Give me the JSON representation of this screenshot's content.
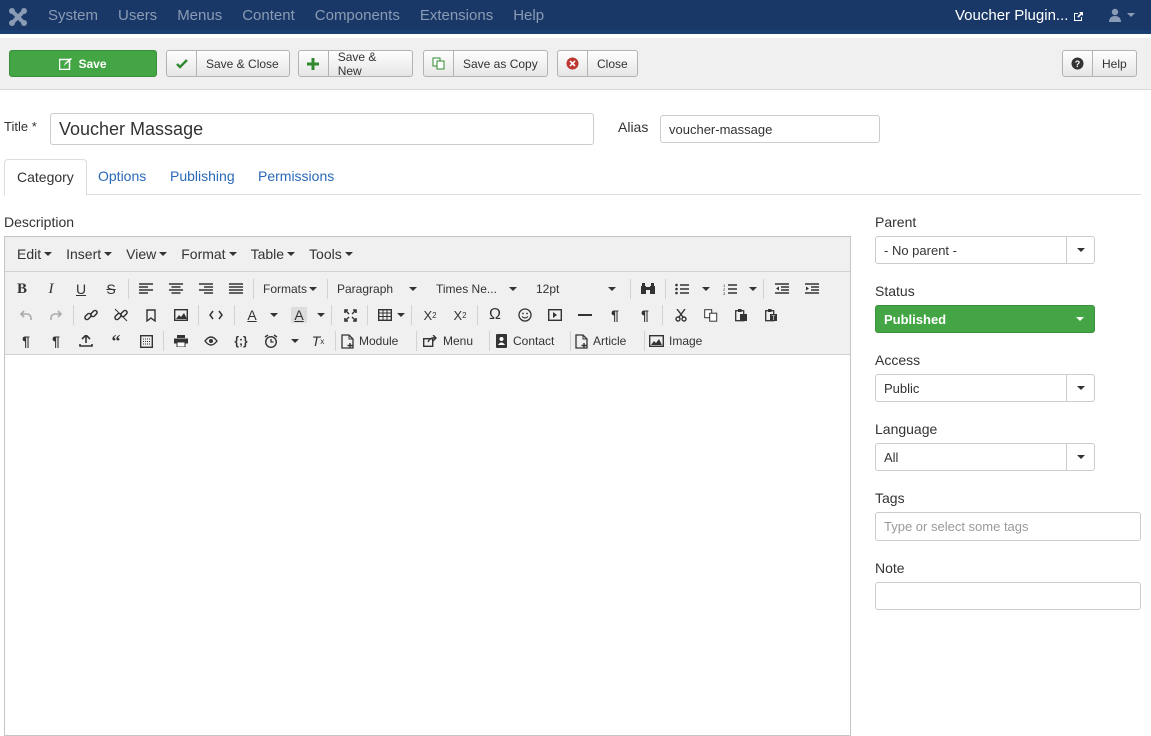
{
  "navbar": {
    "menu": [
      "System",
      "Users",
      "Menus",
      "Content",
      "Components",
      "Extensions",
      "Help"
    ],
    "site_link": "Voucher Plugin..."
  },
  "toolbar": {
    "save": "Save",
    "save_close": "Save & Close",
    "save_new": "Save & New",
    "save_copy": "Save as Copy",
    "close": "Close",
    "help": "Help"
  },
  "form": {
    "title_label": "Title *",
    "title_value": "Voucher Massage",
    "alias_label": "Alias",
    "alias_value": "voucher-massage"
  },
  "tabs": [
    "Category",
    "Options",
    "Publishing",
    "Permissions"
  ],
  "editor": {
    "description_label": "Description",
    "menus": [
      "Edit",
      "Insert",
      "View",
      "Format",
      "Table",
      "Tools"
    ],
    "formats": "Formats",
    "block": "Paragraph",
    "font": "Times Ne...",
    "size": "12pt",
    "buttons": {
      "module": "Module",
      "menu": "Menu",
      "contact": "Contact",
      "article": "Article",
      "image": "Image"
    }
  },
  "sidebar": {
    "parent_label": "Parent",
    "parent_value": "- No parent -",
    "status_label": "Status",
    "status_value": "Published",
    "access_label": "Access",
    "access_value": "Public",
    "language_label": "Language",
    "language_value": "All",
    "tags_label": "Tags",
    "tags_placeholder": "Type or select some tags",
    "note_label": "Note",
    "note_value": ""
  },
  "colors": {
    "navbar": "#1a3867",
    "success": "#43a543",
    "link": "#2a69b8"
  }
}
